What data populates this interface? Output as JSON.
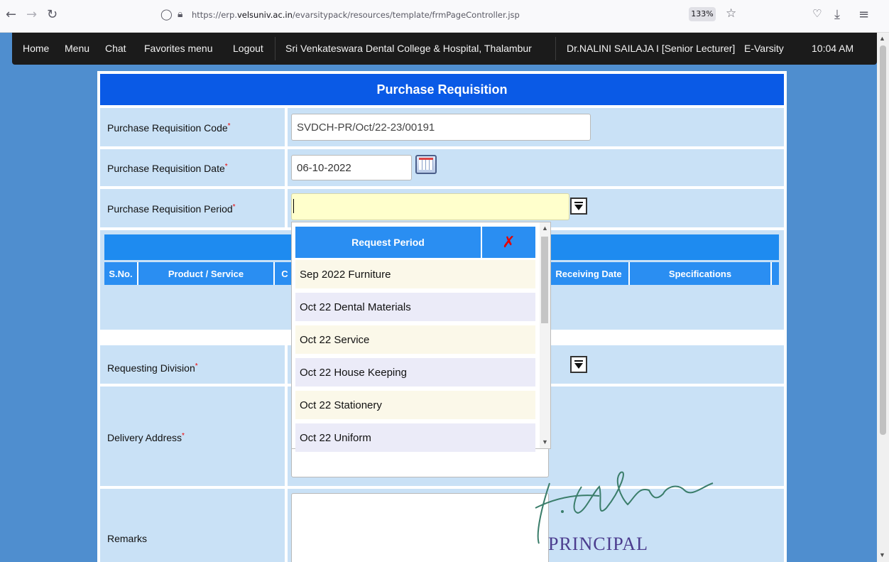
{
  "browser": {
    "url_prefix": "https://erp.",
    "url_domain": "velsuniv.ac.in",
    "url_path": "/evarsitypack/resources/template/frmPageController.jsp",
    "zoom": "133%"
  },
  "topnav": {
    "home": "Home",
    "menu": "Menu",
    "chat": "Chat",
    "favorites": "Favorites menu",
    "logout": "Logout",
    "college": "Sri Venkateswara Dental College & Hospital, Thalambur",
    "user": "Dr.NALINI SAILAJA I [Senior Lecturer]",
    "product": "E-Varsity",
    "time": "10:04 AM"
  },
  "form": {
    "title": "Purchase Requisition",
    "code_label": "Purchase Requisition Code",
    "code_value": "SVDCH-PR/Oct/22-23/00191",
    "date_label": "Purchase Requisition Date",
    "date_value": "06-10-2022",
    "period_label": "Purchase Requisition Period",
    "period_value": "",
    "grid_columns": {
      "sno": "S.No.",
      "product": "Product / Service",
      "c": "C",
      "receiving": "Receiving Date",
      "specs": "Specifications"
    },
    "division_label": "Requesting Division",
    "address_label": "Delivery Address",
    "remarks_label": "Remarks",
    "required_mark": "*"
  },
  "popup": {
    "header": "Request Period",
    "close_glyph": "✗",
    "items": [
      "Sep 2022 Furniture",
      "Oct 22 Dental Materials",
      "Oct 22 Service",
      "Oct 22 House Keeping",
      "Oct 22 Stationery",
      "Oct 22 Uniform"
    ]
  },
  "stamp": {
    "principal": "PRINCIPAL"
  },
  "colors": {
    "page_bg": "#4f8ecf",
    "title_bar": "#0a5ae6",
    "row_bg": "#c9e1f6",
    "header_blue": "#2a8ef2",
    "focused_input": "#ffffcc"
  }
}
